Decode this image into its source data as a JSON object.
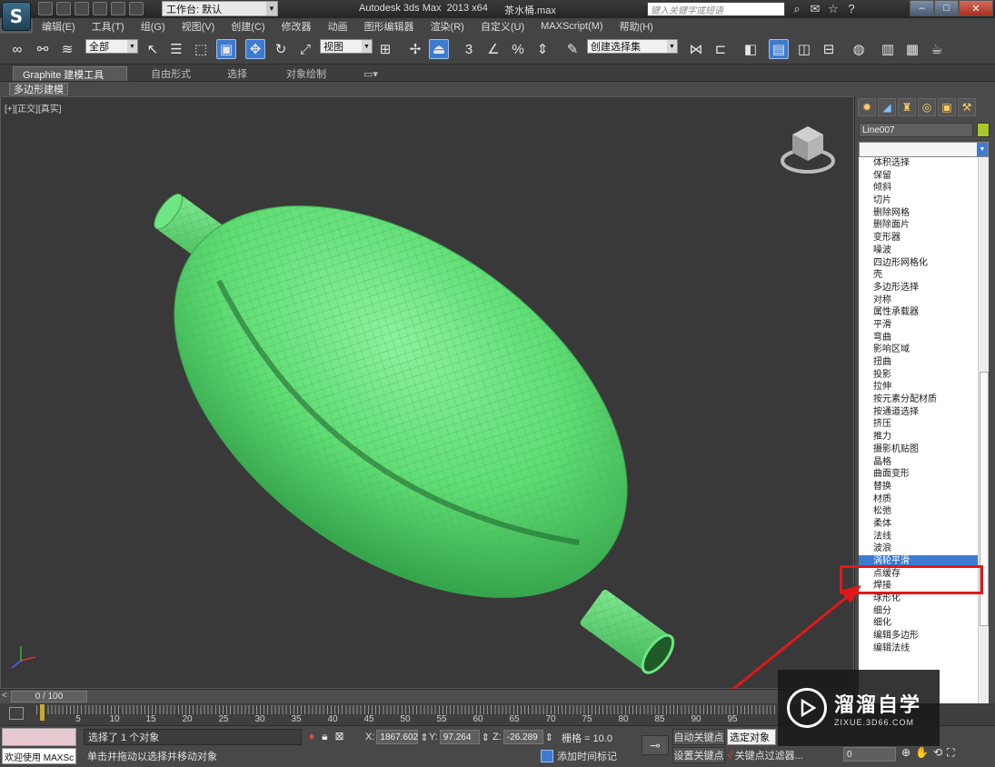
{
  "titlebar": {
    "workspace": "工作台: 默认",
    "title": "Autodesk 3ds Max  2013 x64",
    "filename": "茶水桶.max",
    "search_placeholder": "键入关键字或短语"
  },
  "menu": [
    "编辑(E)",
    "工具(T)",
    "组(G)",
    "视图(V)",
    "创建(C)",
    "修改器",
    "动画",
    "图形编辑器",
    "渲染(R)",
    "自定义(U)",
    "MAXScript(M)",
    "帮助(H)"
  ],
  "toolbar": {
    "filter_select": "全部",
    "ref_coord_select": "视图",
    "named_selection": "创建选择集",
    "snap_label_1": "3",
    "snap_label_2": "%"
  },
  "ribbon": {
    "tabs": [
      "Graphite 建模工具",
      "自由形式",
      "选择",
      "对象绘制"
    ],
    "active_tab": "Graphite 建模工具",
    "subtab": "多边形建模"
  },
  "viewport": {
    "label": "[+][正交][真实]",
    "object_color": "#64e07a"
  },
  "command_panel": {
    "object_name": "Line007",
    "object_color": "#a8c82a",
    "modifiers": [
      "体积选择",
      "保留",
      "倾斜",
      "切片",
      "删除网格",
      "删除面片",
      "变形器",
      "噪波",
      "四边形网格化",
      "壳",
      "多边形选择",
      "对称",
      "属性承载器",
      "平滑",
      "弯曲",
      "影响区域",
      "扭曲",
      "投影",
      "拉伸",
      "按元素分配材质",
      "按通道选择",
      "挤压",
      "推力",
      "摄影机贴图",
      "晶格",
      "曲面变形",
      "替换",
      "材质",
      "松弛",
      "柔体",
      "法线",
      "波浪",
      "涡轮平滑",
      "点缓存",
      "焊接",
      "球形化",
      "细分",
      "细化",
      "编辑多边形",
      "编辑法线"
    ],
    "selected_modifier": "涡轮平滑",
    "selected_index": 32
  },
  "timeline": {
    "frame_display": "0 / 100",
    "ticks": [
      "5",
      "10",
      "15",
      "20",
      "25",
      "30",
      "35",
      "40",
      "45",
      "50",
      "55",
      "60",
      "65",
      "70",
      "75",
      "80",
      "85",
      "90",
      "95"
    ]
  },
  "status": {
    "welcome": "欢迎使用 MAXSc",
    "selection": "选择了 1 个对象",
    "prompt": "单击并拖动以选择并移动对象",
    "x_label": "X:",
    "x_value": "1867.602",
    "y_label": "Y:",
    "y_value": "97.264",
    "z_label": "Z:",
    "z_value": "-26.289",
    "grid": "栅格 = 10.0",
    "add_time_tag": "添加时间标记",
    "auto_key": "自动关键点",
    "set_key": "设置关键点",
    "selected_object": "选定对象",
    "key_filters": "关键点过滤器...",
    "current_frame": "0"
  },
  "watermark": {
    "brand": "溜溜自学",
    "url": "ZIXUE.3D66.COM"
  }
}
